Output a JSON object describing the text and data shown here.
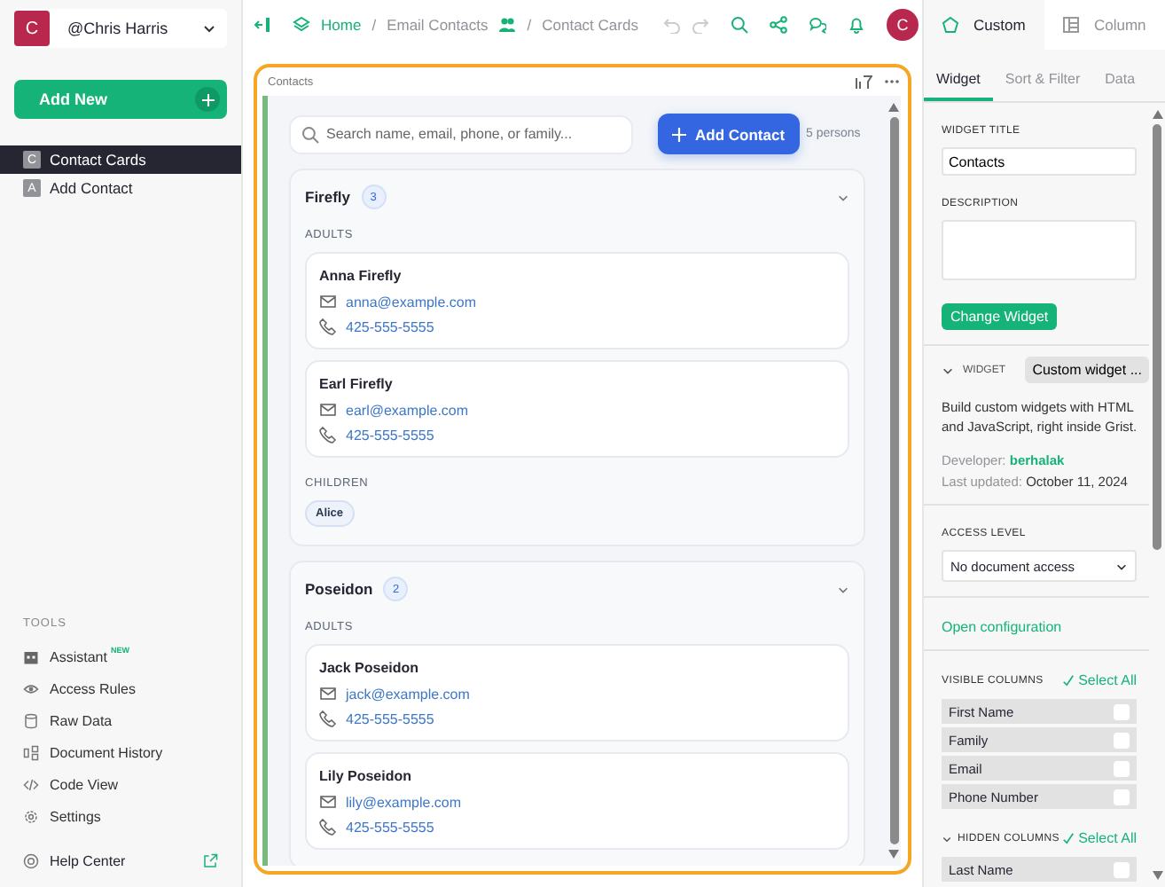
{
  "account": {
    "initial": "C",
    "name": "@Chris Harris"
  },
  "add_new": {
    "label": "Add New"
  },
  "pages": [
    {
      "initial": "C",
      "label": "Contact Cards",
      "selected": true
    },
    {
      "initial": "A",
      "label": "Add Contact",
      "selected": false
    }
  ],
  "tools": {
    "heading": "TOOLS",
    "items": [
      {
        "label": "Assistant",
        "badge": "NEW"
      },
      {
        "label": "Access Rules"
      },
      {
        "label": "Raw Data"
      },
      {
        "label": "Document History"
      },
      {
        "label": "Code View"
      },
      {
        "label": "Settings"
      }
    ]
  },
  "help": {
    "label": "Help Center"
  },
  "breadcrumb": [
    {
      "kind": "link",
      "label": "Home"
    },
    {
      "kind": "separator",
      "label": "/"
    },
    {
      "kind": "text",
      "label": "Email Contacts"
    },
    {
      "kind": "separator",
      "label": "/"
    },
    {
      "kind": "text",
      "label": "Contact Cards"
    }
  ],
  "avatar": "C",
  "widget": {
    "title": "Contacts",
    "search_placeholder": "Search name, email, phone, or family...",
    "add_button": "Add Contact",
    "count": "5 persons",
    "families": [
      {
        "name": "Firefly",
        "count": "3",
        "expanded": true,
        "groups": [
          {
            "heading": "ADULTS",
            "kind": "cards",
            "people": [
              {
                "name": "Anna Firefly",
                "email": "anna@example.com",
                "phone": "425-555-5555"
              },
              {
                "name": "Earl Firefly",
                "email": "earl@example.com",
                "phone": "425-555-5555"
              }
            ]
          },
          {
            "heading": "CHILDREN",
            "kind": "chips",
            "people": [
              {
                "name": "Alice"
              }
            ]
          }
        ]
      },
      {
        "name": "Poseidon",
        "count": "2",
        "expanded": true,
        "groups": [
          {
            "heading": "ADULTS",
            "kind": "cards",
            "people": [
              {
                "name": "Jack Poseidon",
                "email": "jack@example.com",
                "phone": "425-555-5555"
              },
              {
                "name": "Lily Poseidon",
                "email": "lily@example.com",
                "phone": "425-555-5555"
              }
            ]
          }
        ]
      }
    ]
  },
  "panel": {
    "tabs": [
      {
        "label": "Custom",
        "selected": true
      },
      {
        "label": "Column",
        "selected": false
      }
    ],
    "subtabs": [
      {
        "label": "Widget",
        "selected": true
      },
      {
        "label": "Sort & Filter",
        "selected": false
      },
      {
        "label": "Data",
        "selected": false
      }
    ],
    "widget_title_label": "WIDGET TITLE",
    "widget_title": "Contacts",
    "description_label": "DESCRIPTION",
    "change_button": "Change Widget",
    "widget_label": "WIDGET",
    "widget_select": "Custom widget ...",
    "about": "Build custom widgets with HTML and JavaScript, right inside Grist.",
    "developer_label": "Developer:",
    "developer": "berhalak",
    "updated_label": "Last updated:",
    "updated": "October 11, 2024",
    "access_label": "ACCESS LEVEL",
    "access": "No document access",
    "open_config": "Open configuration",
    "visible": {
      "heading": "VISIBLE COLUMNS",
      "select_all": "Select All",
      "columns": [
        {
          "label": "First Name",
          "checked": false
        },
        {
          "label": "Family",
          "checked": false
        },
        {
          "label": "Email",
          "checked": false
        },
        {
          "label": "Phone Number",
          "checked": false
        }
      ]
    },
    "hidden": {
      "heading": "HIDDEN COLUMNS",
      "select_all": "Select All",
      "expanded": true,
      "columns": [
        {
          "label": "Last Name",
          "checked": false
        }
      ]
    }
  }
}
